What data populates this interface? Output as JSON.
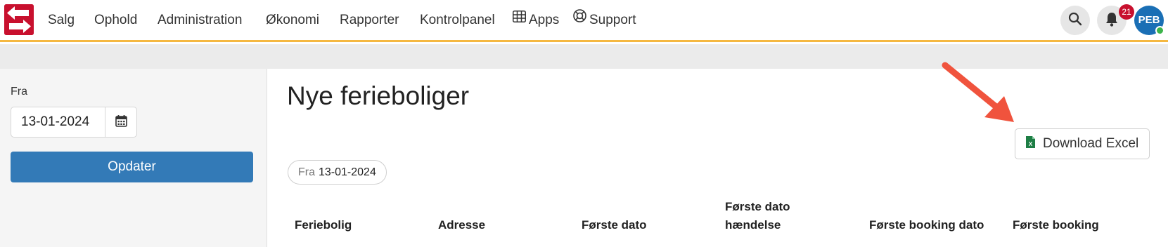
{
  "navbar": {
    "menu": [
      {
        "label": "Salg"
      },
      {
        "label": "Ophold"
      },
      {
        "label": "Administration"
      },
      {
        "label": "Økonomi"
      },
      {
        "label": "Rapporter"
      },
      {
        "label": "Kontrolpanel"
      },
      {
        "label": "Apps",
        "icon": "grid-icon"
      },
      {
        "label": "Support",
        "icon": "lifebuoy-icon"
      }
    ],
    "notification_count": "21",
    "user_initials": "PEB",
    "accent_color": "#f5b841",
    "brand_color": "#c8102e"
  },
  "sidebar": {
    "from_label": "Fra",
    "from_value": "13-01-2024",
    "update_label": "Opdater"
  },
  "main": {
    "title": "Nye ferieboliger",
    "download_label": "Download Excel",
    "filter": {
      "key": "Fra",
      "value": "13-01-2024"
    },
    "table_headers": [
      "Feriebolig",
      "Adresse",
      "Første dato",
      "Første dato hændelse",
      "Første booking dato",
      "Første booking"
    ]
  }
}
